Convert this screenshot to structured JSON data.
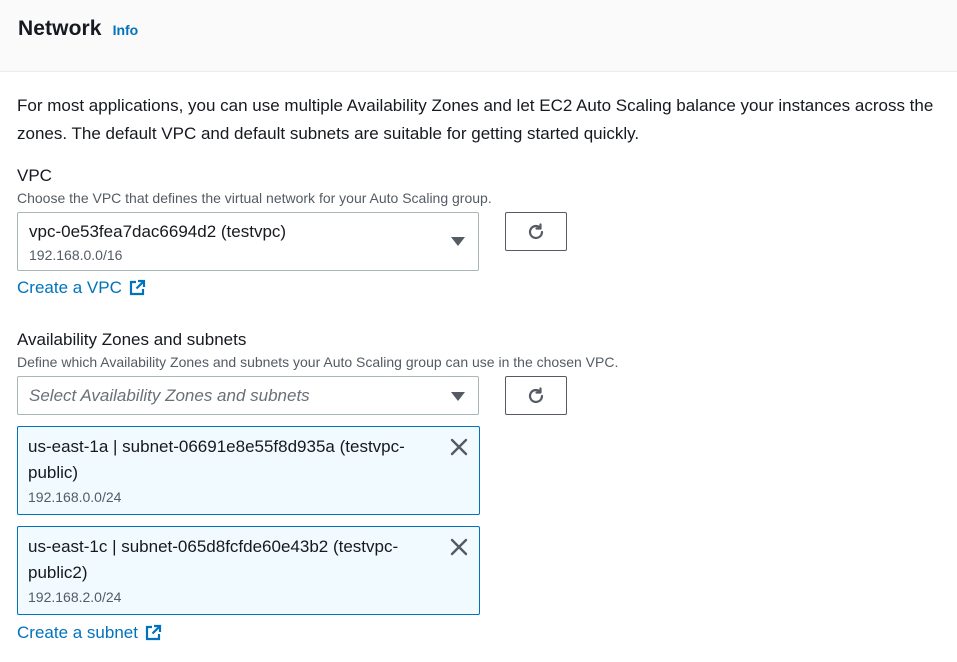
{
  "header": {
    "title": "Network",
    "info_label": "Info"
  },
  "description": "For most applications, you can use multiple Availability Zones and let EC2 Auto Scaling balance your instances across the zones. The default VPC and default subnets are suitable for getting started quickly.",
  "vpc": {
    "label": "VPC",
    "hint": "Choose the VPC that defines the virtual network for your Auto Scaling group.",
    "selected_value": "vpc-0e53fea7dac6694d2 (testvpc)",
    "selected_sub": "192.168.0.0/16",
    "create_link": "Create a VPC"
  },
  "az": {
    "label": "Availability Zones and subnets",
    "hint": "Define which Availability Zones and subnets your Auto Scaling group can use in the chosen VPC.",
    "placeholder": "Select Availability Zones and subnets",
    "tokens": [
      {
        "text": "us-east-1a | subnet-06691e8e55f8d935a (testvpc-public)",
        "sub": "192.168.0.0/24"
      },
      {
        "text": "us-east-1c | subnet-065d8fcfde60e43b2 (testvpc-public2)",
        "sub": "192.168.2.0/24"
      }
    ],
    "create_link": "Create a subnet"
  },
  "icons": {
    "refresh": "refresh-icon",
    "external": "external-link-icon",
    "dropdown": "caret-down-icon",
    "remove": "close-icon"
  },
  "colors": {
    "link": "#0073bb",
    "token_bg": "#f1faff",
    "token_border": "#0073bb"
  }
}
